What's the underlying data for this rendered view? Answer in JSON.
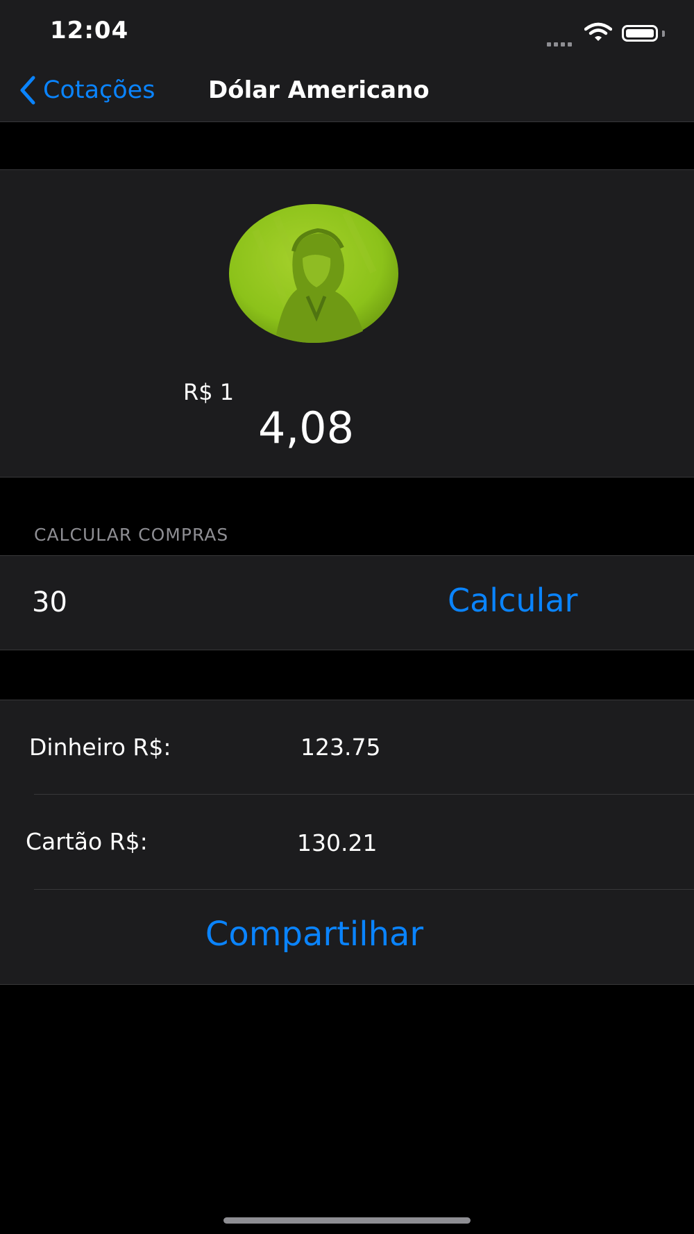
{
  "status_bar": {
    "time": "12:04"
  },
  "nav": {
    "back_label": "Cotações",
    "title": "Dólar Americano"
  },
  "quote": {
    "unit_label": "R$ 1",
    "value": "4,08"
  },
  "calculator": {
    "section_header": "CALCULAR COMPRAS",
    "amount_value": "30",
    "calc_button_label": "Calcular"
  },
  "results": {
    "cash_label": "Dinheiro R$:",
    "cash_value": "123.75",
    "card_label": "Cartão R$:",
    "card_value": "130.21",
    "share_button_label": "Compartilhar"
  },
  "colors": {
    "accent": "#0a84ff",
    "cell_background": "#1c1c1e",
    "coin_green": "#8cc21a"
  },
  "icons": [
    "chevron-left-icon",
    "wifi-icon",
    "battery-icon",
    "cellular-signal-icon",
    "dollar-coin-icon"
  ]
}
